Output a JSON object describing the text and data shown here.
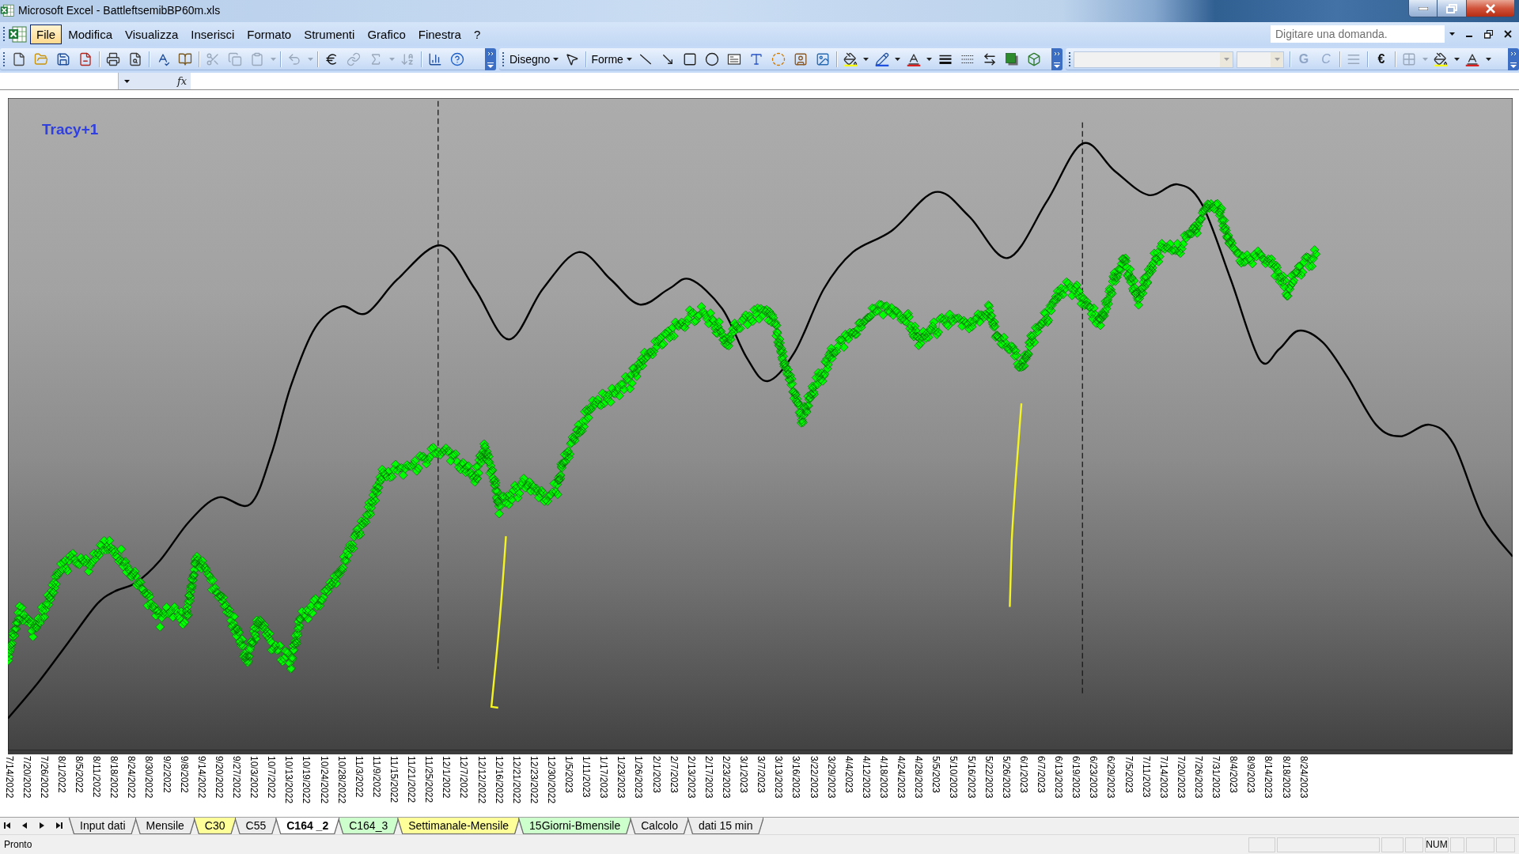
{
  "window": {
    "title": "Microsoft Excel - BattleftsemibBP60m.xls"
  },
  "menu_bar": {
    "items": [
      {
        "label": "File",
        "selected": true
      },
      {
        "label": "Modifica",
        "selected": false
      },
      {
        "label": "Visualizza",
        "selected": false
      },
      {
        "label": "Inserisci",
        "selected": false
      },
      {
        "label": "Formato",
        "selected": false
      },
      {
        "label": "Strumenti",
        "selected": false
      },
      {
        "label": "Grafico",
        "selected": false
      },
      {
        "label": "Finestra",
        "selected": false
      },
      {
        "label": "?",
        "selected": false
      }
    ],
    "help_search": {
      "placeholder": "Digitare una domanda."
    }
  },
  "standard_toolbar": {
    "groups": [
      [
        {
          "kind": "new",
          "disabled": false
        },
        {
          "kind": "open",
          "disabled": false
        },
        {
          "kind": "save",
          "disabled": false
        },
        {
          "kind": "permission",
          "disabled": false
        }
      ],
      [
        {
          "kind": "print",
          "disabled": false
        },
        {
          "kind": "print-preview",
          "disabled": false
        }
      ],
      [
        {
          "kind": "spelling",
          "disabled": false
        },
        {
          "kind": "research",
          "disabled": false
        }
      ],
      [
        {
          "kind": "cut",
          "disabled": true
        },
        {
          "kind": "copy",
          "disabled": true
        },
        {
          "kind": "paste",
          "disabled": true,
          "dropdown": true
        }
      ],
      [
        {
          "kind": "undo",
          "disabled": true,
          "dropdown": true
        }
      ],
      [
        {
          "kind": "euro-conversion",
          "disabled": false
        },
        {
          "kind": "hyperlink",
          "disabled": true
        },
        {
          "kind": "autosum",
          "disabled": true,
          "dropdown": true
        },
        {
          "kind": "sort",
          "disabled": true
        }
      ],
      [
        {
          "kind": "chart-wizard",
          "disabled": false
        },
        {
          "kind": "help",
          "disabled": false
        }
      ]
    ]
  },
  "drawing_toolbar": {
    "groups": [
      [
        {
          "kind": "menu",
          "label": "Disegno"
        },
        {
          "kind": "select"
        }
      ],
      [
        {
          "kind": "menu",
          "label": "Forme"
        },
        {
          "kind": "line"
        },
        {
          "kind": "arrow"
        },
        {
          "kind": "rectangle"
        },
        {
          "kind": "oval"
        },
        {
          "kind": "textbox"
        },
        {
          "kind": "wordart"
        },
        {
          "kind": "diagram"
        },
        {
          "kind": "clipart"
        },
        {
          "kind": "picture"
        }
      ],
      [
        {
          "kind": "fill-color",
          "dropdown": true
        },
        {
          "kind": "line-color",
          "dropdown": true
        },
        {
          "kind": "font-color",
          "dropdown": true
        },
        {
          "kind": "line-style"
        },
        {
          "kind": "dash-style"
        },
        {
          "kind": "arrow-style"
        },
        {
          "kind": "shadow"
        },
        {
          "kind": "extrusion"
        }
      ]
    ]
  },
  "formatting_toolbar": {
    "groups": [
      [
        {
          "kind": "font-name",
          "disabled": true
        },
        {
          "kind": "font-size",
          "disabled": true
        }
      ],
      [
        {
          "kind": "bold",
          "label": "G",
          "disabled": true
        },
        {
          "kind": "italic",
          "label": "C",
          "disabled": true
        }
      ],
      [
        {
          "kind": "align",
          "disabled": true
        }
      ],
      [
        {
          "kind": "text",
          "label": "€",
          "disabled": false
        }
      ],
      [
        {
          "kind": "borders",
          "disabled": true,
          "dropdown": true
        },
        {
          "kind": "fill-color",
          "disabled": false,
          "dropdown": true
        },
        {
          "kind": "font-color",
          "disabled": false,
          "dropdown": true
        }
      ]
    ]
  },
  "formula_bar": {
    "function_label": "fx"
  },
  "chart": {
    "label": "Tracy+1",
    "x_axis_labels": [
      "7/14/2022",
      "7/20/2022",
      "7/26/2022",
      "8/1/2022",
      "8/5/2022",
      "8/11/2022",
      "8/18/2022",
      "8/24/2022",
      "8/30/2022",
      "9/2/2022",
      "9/8/2022",
      "9/14/2022",
      "9/20/2022",
      "9/27/2022",
      "10/3/2022",
      "10/7/2022",
      "10/13/2022",
      "10/19/2022",
      "10/24/2022",
      "10/28/2022",
      "11/3/2022",
      "11/9/2022",
      "11/15/2022",
      "11/21/2022",
      "11/25/2022",
      "12/1/2022",
      "12/7/2022",
      "12/12/2022",
      "12/16/2022",
      "12/21/2022",
      "12/23/2022",
      "12/30/2022",
      "1/5/2023",
      "1/11/2023",
      "1/17/2023",
      "1/23/2023",
      "1/26/2023",
      "2/1/2023",
      "2/7/2023",
      "2/13/2023",
      "2/17/2023",
      "2/23/2023",
      "3/1/2023",
      "3/7/2023",
      "3/13/2023",
      "3/16/2023",
      "3/22/2023",
      "3/29/2023",
      "4/4/2023",
      "4/12/2023",
      "4/18/2023",
      "4/24/2023",
      "4/28/2023",
      "5/5/2023",
      "5/10/2023",
      "5/16/2023",
      "5/22/2023",
      "5/26/2023",
      "6/1/2023",
      "6/7/2023",
      "6/13/2023",
      "6/19/2023",
      "6/23/2023",
      "6/29/2023",
      "7/5/2023",
      "7/11/2023",
      "7/14/2023",
      "7/20/2023",
      "7/26/2023",
      "7/31/2023",
      "8/4/2023",
      "8/9/2023",
      "8/14/2023",
      "8/18/2023",
      "8/24/2023"
    ]
  },
  "sheet_tabs": [
    {
      "label": "Input dati",
      "selected": false
    },
    {
      "label": "Mensile",
      "selected": false
    },
    {
      "label": "C30",
      "selected": false,
      "color": "#ffff99"
    },
    {
      "label": "C55",
      "selected": false
    },
    {
      "label": "C164 _2",
      "selected": true
    },
    {
      "label": "C164_3",
      "selected": false,
      "color": "#ccffcc"
    },
    {
      "label": "Settimanale-Mensile",
      "selected": false,
      "color": "#ffff99"
    },
    {
      "label": "15Giorni-Bmensile",
      "selected": false,
      "color": "#ccffcc"
    },
    {
      "label": "Calcolo",
      "selected": false
    },
    {
      "label": "dati 15 min",
      "selected": false
    }
  ],
  "status_bar": {
    "text": "Pronto",
    "indicators": [
      "NUM"
    ]
  }
}
